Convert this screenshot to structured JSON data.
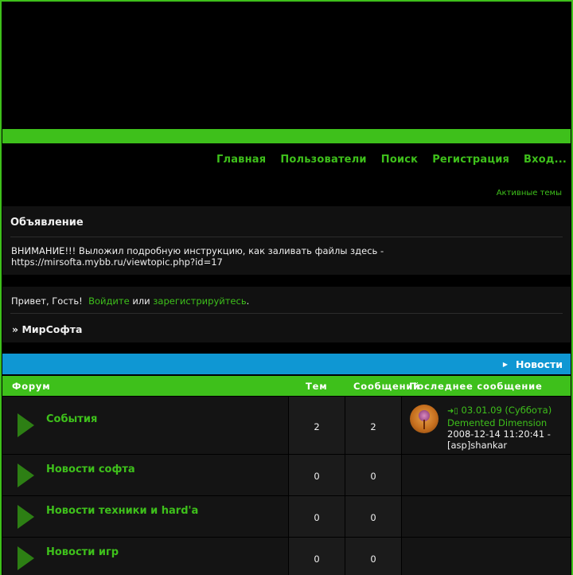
{
  "nav": {
    "items": [
      "Главная",
      "Пользователи",
      "Поиск",
      "Регистрация",
      "Вход..."
    ],
    "active_topics": "Активные темы"
  },
  "announcement": {
    "title": "Объявление",
    "text": "ВНИМАНИЕ!!! Выложил подробную инструкцию, как заливать файлы здесь - https://mirsofta.mybb.ru/viewtopic.php?id=17"
  },
  "welcome": {
    "greeting": "Привет, Гость!",
    "login_link": "Войдите",
    "or": "или",
    "register_link": "зарегистрируйтесь",
    "period": "."
  },
  "breadcrumb": {
    "prefix": "»",
    "label": "МирСофта"
  },
  "category": {
    "title": "Новости",
    "icon": "triangle-right-icon"
  },
  "columns": {
    "forum": "Форум",
    "topics": "Тем",
    "posts": "Сообщений",
    "last_post": "Последнее сообщение"
  },
  "forums": [
    {
      "name": "События",
      "topics": "2",
      "posts": "2",
      "last_post": {
        "title": "03.01.09 (Суббота) Demented Dimension",
        "date": "2008-12-14 11:20:41 -",
        "author": "[asp]shankar"
      }
    },
    {
      "name": "Новости софта",
      "topics": "0",
      "posts": "0"
    },
    {
      "name": "Новости техники и hard'а",
      "topics": "0",
      "posts": "0"
    },
    {
      "name": "Новости игр",
      "topics": "0",
      "posts": "0"
    }
  ],
  "colors": {
    "accent": "#3ec01b",
    "category_bar": "#0f97d3",
    "background": "#000000"
  }
}
